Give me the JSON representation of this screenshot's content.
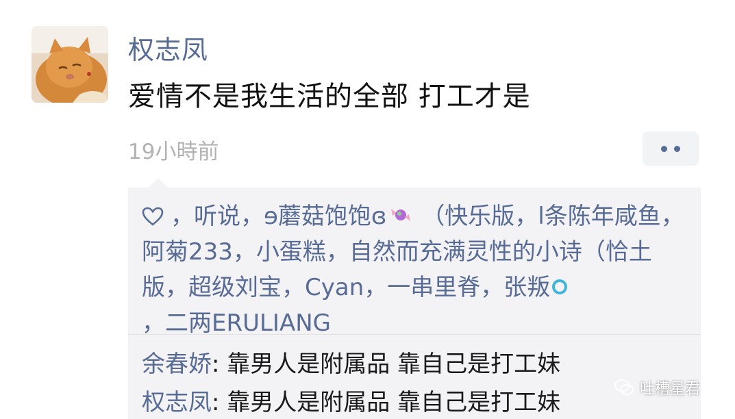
{
  "post": {
    "author": "权志凤",
    "text": "爱情不是我生活的全部 打工才是",
    "time": "19小時前",
    "avatar_icon": "cat-avatar"
  },
  "likes": {
    "icon": "heart-icon",
    "names": [
      "，听说，ɘ蘑菇饱饱ɞ",
      "（快乐版，",
      "l条陈年咸鱼",
      "阿菊233",
      "小蛋糕",
      "自然而充满灵性的小诗（恰土版",
      "超级刘宝",
      "Cyan",
      "一串里脊",
      "张叛",
      "二两ERULIANG"
    ]
  },
  "comments": [
    {
      "name": "余春娇",
      "text": "靠男人是附属品 靠自己是打工妹"
    },
    {
      "name": "权志凤",
      "text": "靠男人是附属品 靠自己是打工妹"
    }
  ],
  "watermark": {
    "text": "吐槽星君",
    "icon": "wechat-logo-icon"
  },
  "colors": {
    "link": "#576b95",
    "timestamp": "#b2b2b2",
    "comment_bg": "#f3f3f5"
  }
}
